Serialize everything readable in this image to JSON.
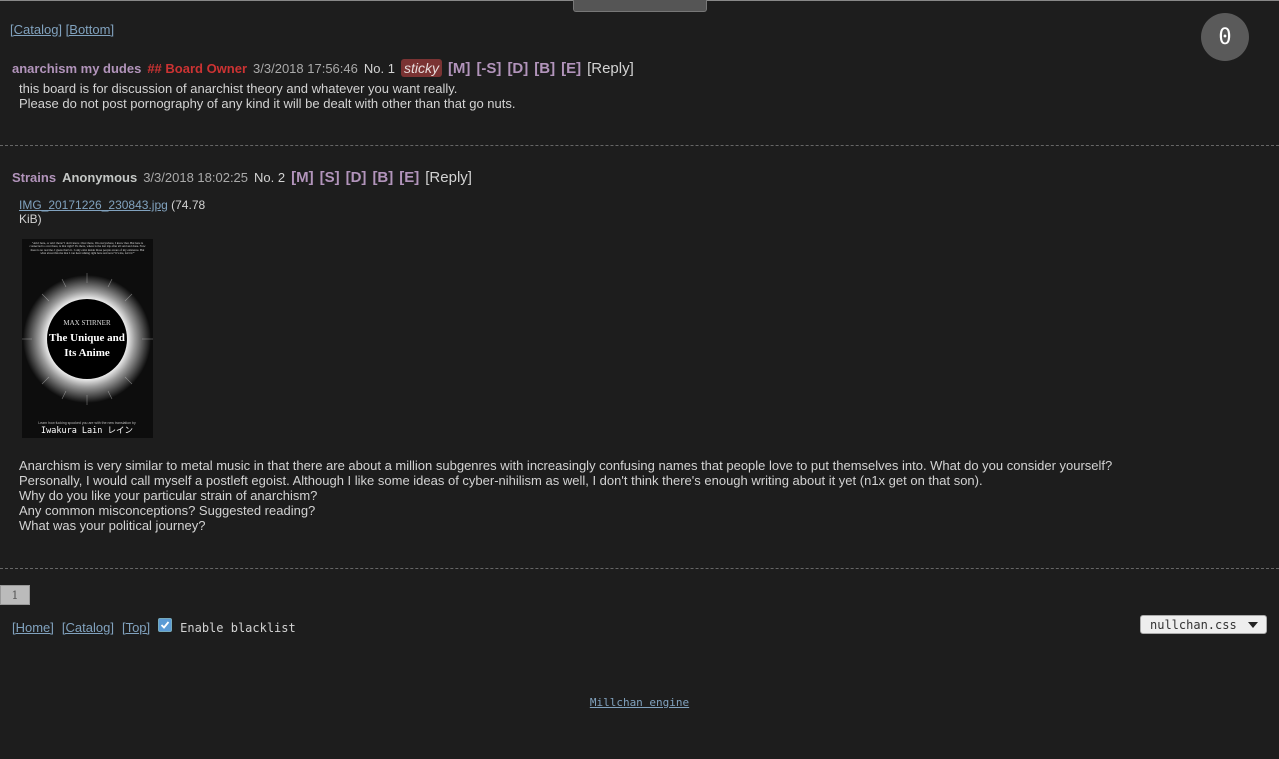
{
  "nav_top": {
    "catalog": "[Catalog]",
    "bottom": "[Bottom]"
  },
  "counter": "0",
  "posts": [
    {
      "subject": "anarchism my dudes",
      "capcode": "## Board Owner",
      "date": "3/3/2018 17:56:46",
      "number": "No. 1",
      "sticky": "sticky",
      "mod_actions": [
        "[M]",
        "[-S]",
        "[D]",
        "[B]",
        "[E]"
      ],
      "reply": "[Reply]",
      "body": [
        "this board is for discussion of anarchist theory and whatever you want really.",
        "Please do not post pornography of any kind it will be dealt with other than that go nuts."
      ]
    },
    {
      "subject": "Strains",
      "name": "Anonymous",
      "date": "3/3/2018 18:02:25",
      "number": "No. 2",
      "mod_actions": [
        "[M]",
        "[S]",
        "[D]",
        "[B]",
        "[E]"
      ],
      "reply": "[Reply]",
      "file": {
        "name": "IMG_20171226_230843.jpg",
        "size_part1": "(74.78",
        "size_part2": "KiB)"
      },
      "image": {
        "top_text": "\"Am I here, or am I there? I don't know. Over there, I'm everywhere. I know that. But here is connected to over there, is that right? It's there, where is the last trip after all said and done. Now there is no real me. I guess that's it. I only exist inside those people aware of my existence. But what about this me that I can hear talking right here and now? It's me, isn't it?\"",
        "author": "MAX STIRNER",
        "title_line1": "The Unique and",
        "title_line2": "Its Anime",
        "small": "Learn how fucking spooked you are with the new translation by",
        "translator": "Iwakura Lain レイン"
      },
      "body": [
        "Anarchism is very similar to metal music in that there are about a million subgenres with increasingly confusing names that people love to put themselves into. What do you consider yourself?",
        "Personally, I would call myself a postleft egoist. Although I like some ideas of cyber-nihilism as well, I don't think there's enough writing about it yet (n1x get on that son).",
        "Why do you like your particular strain of anarchism?",
        "Any common misconceptions? Suggested reading?",
        "What was your political journey?"
      ]
    }
  ],
  "pager": "1",
  "footer": {
    "home": "[Home]",
    "catalog": "[Catalog]",
    "top": "[Top]",
    "blacklist_label": "Enable blacklist",
    "blacklist_checked": true,
    "stylesheet": "nullchan.css",
    "engine": "Millchan engine"
  }
}
